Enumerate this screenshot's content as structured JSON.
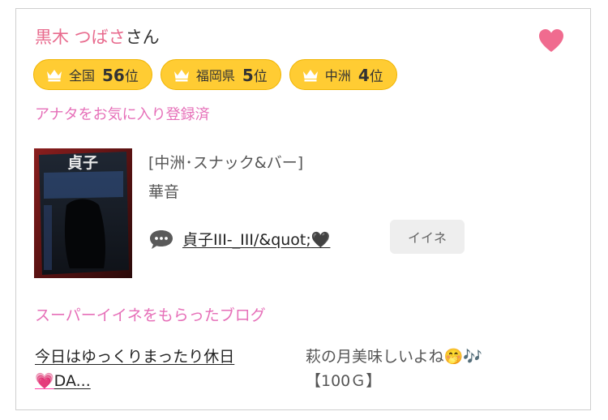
{
  "user": {
    "name": "黒木 つばさ",
    "suffix": "さん"
  },
  "favorite_heart_color": "#f06b8f",
  "rankings": [
    {
      "area": "全国",
      "rank": "56",
      "unit": "位"
    },
    {
      "area": "福岡県",
      "rank": "5",
      "unit": "位"
    },
    {
      "area": "中洲",
      "rank": "4",
      "unit": "位"
    }
  ],
  "favorite_status": "アナタをお気に入り登録済",
  "post": {
    "shop_type": "[中洲･スナック&バー]",
    "shop_name": "華音",
    "title": "貞子III-_III/&quot;",
    "title_emoji": "🖤",
    "iine_label": "イイネ",
    "thumbnail_text": "貞子"
  },
  "blog_section_title": "スーパーイイネをもらったブログ",
  "blog": {
    "title_line1": "今日はゆっくりまったり休日",
    "title_heart": "💗",
    "title_line2": "DA...",
    "description_line1": "萩の月美味しいよね🤭🎶",
    "description_line2": "【100Ｇ】"
  },
  "colors": {
    "pink_text": "#e66fb8",
    "badge_yellow": "#ffcc33",
    "name_pink": "#e86b8e"
  }
}
